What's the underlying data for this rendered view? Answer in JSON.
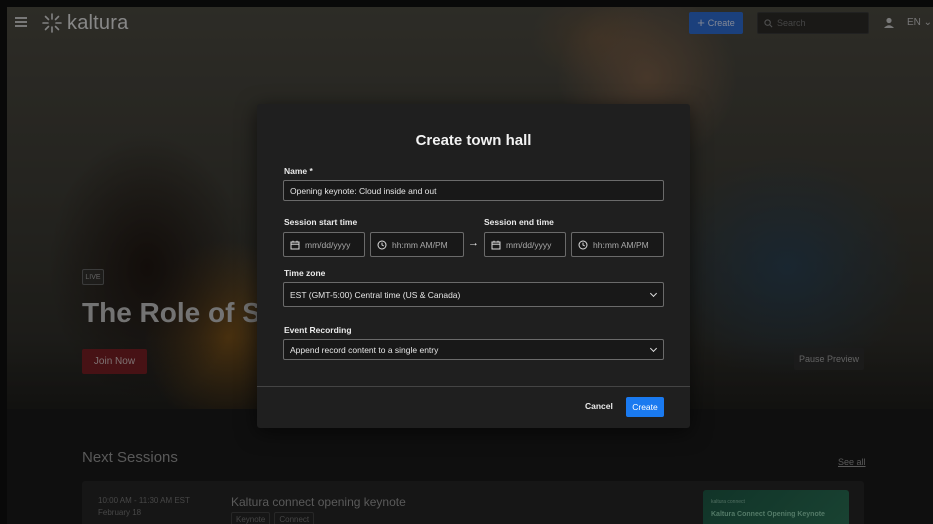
{
  "topbar": {
    "logo_text": "kaltura",
    "create_label": "Create",
    "search_placeholder": "Search",
    "language": "EN"
  },
  "hero": {
    "badge": "LIVE",
    "title": "The Role of S",
    "join_label": "Join Now",
    "pause_label": "Pause Preview"
  },
  "next_sessions": {
    "heading": "Next Sessions",
    "see_all": "See all",
    "sessions": [
      {
        "time": "10:00 AM - 11:30 AM EST",
        "date": "February 18",
        "title": "Kaltura connect opening keynote",
        "tags": [
          "Keynote",
          "Connect"
        ],
        "thumb_brand": "kaltura connect",
        "thumb_title": "Kaltura Connect Opening Keynote"
      }
    ]
  },
  "modal": {
    "title": "Create town hall",
    "name_label": "Name *",
    "name_value": "Opening keynote: Cloud inside and out",
    "start_label": "Session start time",
    "end_label": "Session end time",
    "date_placeholder": "mm/dd/yyyy",
    "time_placeholder": "hh:mm AM/PM",
    "timezone_label": "Time zone",
    "timezone_value": "EST (GMT-5:00) Central time (US & Canada)",
    "recording_label": "Event Recording",
    "recording_value": "Append record content to a single entry",
    "cancel_label": "Cancel",
    "create_label": "Create"
  },
  "colors": {
    "primary_blue": "#1a7af0",
    "join_red": "#7a1f25",
    "modal_bg": "#1f1f1f"
  }
}
